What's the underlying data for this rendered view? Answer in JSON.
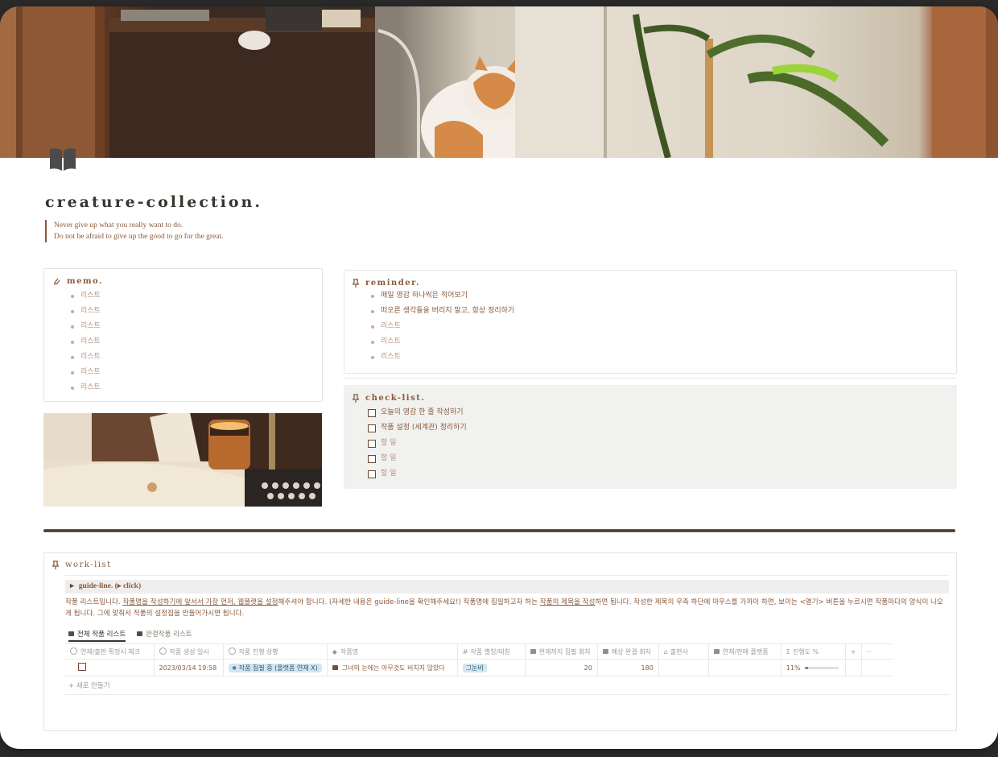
{
  "page": {
    "title": "creature-collection.",
    "quote": [
      "Never give up what you really want to do.",
      "Do not be afraid to give up the good to go for the great."
    ]
  },
  "memo": {
    "title": "memo.",
    "items": [
      "리스트",
      "리스트",
      "리스트",
      "리스트",
      "리스트",
      "리스트",
      "리스트"
    ]
  },
  "reminder": {
    "title": "reminder.",
    "items": [
      "매일 영감 하나씩은 적어보기",
      "떠오른 생각들을 버리지 말고, 항상 정리하기",
      "리스트",
      "리스트",
      "리스트"
    ]
  },
  "checklist": {
    "title": "check-list.",
    "items": [
      {
        "label": "오늘의 영감 한 줄 작성하기",
        "checked": false
      },
      {
        "label": "작품 설정 (세계관) 정리하기",
        "checked": false
      },
      {
        "label": "할 일",
        "checked": false
      },
      {
        "label": "할 일",
        "checked": false
      },
      {
        "label": "할 일",
        "checked": false
      }
    ]
  },
  "worklist": {
    "title": "work-list",
    "guide_toggle": "guide-line. (▸ click)",
    "description": {
      "p1": "작품 리스트입니다. ",
      "u1": "작품명을 작성하기에 앞서서 가장 먼저, 웹플랫을 설정",
      "p2": "해주셔야 합니다. (자세한 내용은 guide-line을 확인해주세요!) 작품명에 집필하고자 하는 ",
      "u2": "작품의 제목을 작성",
      "p3": "하면 됩니다. 작성한 제목의 우측 하단에 마우스를 가까이 하면, 보이는 <열기> 버튼을 누르시면 작품마다의 양식이 나오게 됩니다. 그에 맞춰서 작품의 설정집을 만들어가시면 됩니다."
    },
    "views": [
      "전체 작품 리스트",
      "완결작품 리스트"
    ],
    "columns": [
      "연재/출판 확정시 체크",
      "작품 생성 일시",
      "작품 진행 상황",
      "작품명",
      "작품 별칭/태칭",
      "현재까지 집필 회차",
      "예상 완결 회차",
      "출판사",
      "연재/판매 플랫폼",
      "진행도 %",
      "+",
      "···"
    ],
    "rows": [
      {
        "checked": false,
        "created": "2023/03/14 19:58",
        "status": "작품 집필 중 (플랫폼 연재 X)",
        "name": "그녀의 눈에는 아무것도 비치지 않았다",
        "alias": "그눈비",
        "written": "20",
        "expected": "180",
        "publisher": "",
        "platform": "",
        "progress_label": "11%",
        "progress": 0.11
      }
    ],
    "new_row": "+ 새로 만들기"
  },
  "colors": {
    "accent_brown": "#8b5a3c",
    "select_blue": "#d3e5ef",
    "checklist_bg": "#f1f1ef"
  }
}
